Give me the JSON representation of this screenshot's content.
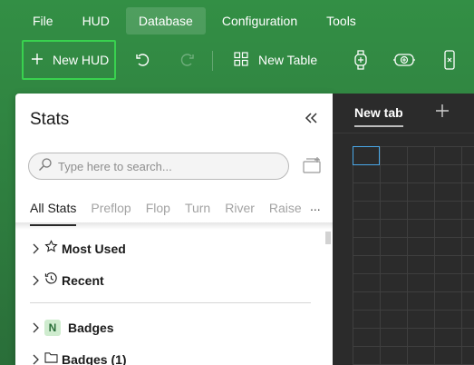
{
  "menu": {
    "items": [
      {
        "label": "File"
      },
      {
        "label": "HUD"
      },
      {
        "label": "Database"
      },
      {
        "label": "Configuration"
      },
      {
        "label": "Tools"
      }
    ],
    "active": "Database"
  },
  "toolbar": {
    "new_hud_label": "New HUD",
    "new_table_label": "New Table",
    "icons": [
      "plus-icon",
      "undo-icon",
      "redo-icon",
      "table-grid-icon",
      "watch-icon",
      "chip-icon",
      "phone-icon"
    ]
  },
  "stats_panel": {
    "title": "Stats",
    "search_placeholder": "Type here to search...",
    "tabs": [
      {
        "label": "All Stats"
      },
      {
        "label": "Preflop"
      },
      {
        "label": "Flop"
      },
      {
        "label": "Turn"
      },
      {
        "label": "River"
      },
      {
        "label": "Raise"
      }
    ],
    "more_label": "...",
    "tree": [
      {
        "label": "Most Used",
        "icon": "star-icon"
      },
      {
        "label": "Recent",
        "icon": "history-icon"
      },
      {
        "label": "Badges",
        "badge": "N"
      },
      {
        "label": "Badges (1)",
        "icon": "folder-icon"
      }
    ]
  },
  "table_area": {
    "tab_label": "New tab",
    "add_tab_label": "+"
  },
  "colors": {
    "accent_green": "#39d24f",
    "background_green": "#2f8140",
    "dark_panel": "#2b2b2b",
    "selection_blue": "#4aa8e8"
  }
}
